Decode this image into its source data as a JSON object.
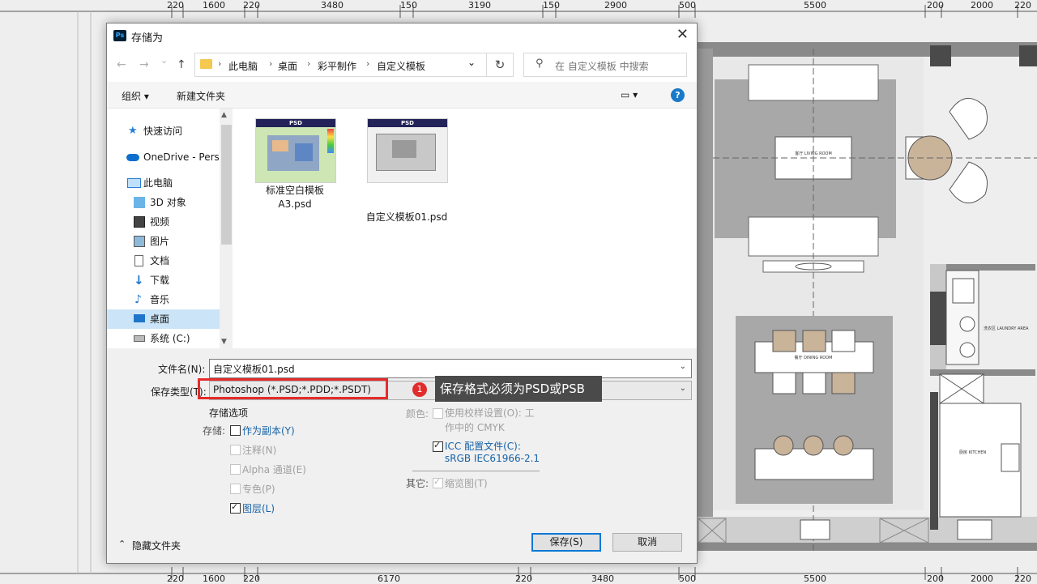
{
  "dialog": {
    "title": "存储为",
    "app_badge": "Ps",
    "close_glyph": "✕"
  },
  "nav": {
    "back_icon": "←",
    "forward_icon": "→",
    "dropdown_icon": "⌄",
    "up_icon": "↑",
    "breadcrumb": [
      "此电脑",
      "桌面",
      "彩平制作",
      "自定义模板"
    ],
    "crumb_sep": "›",
    "refresh_icon": "↻",
    "search_placeholder": "在 自定义模板 中搜索"
  },
  "toolbar": {
    "organize": "组织 ▾",
    "new_folder": "新建文件夹",
    "view_icon": "▭ ▾",
    "help": "?"
  },
  "sidebar": {
    "items": [
      {
        "label": "快速访问",
        "icon": "star-icon"
      },
      {
        "label": "OneDrive - Perso",
        "icon": "cloud-icon"
      },
      {
        "label": "此电脑",
        "icon": "computer-icon"
      },
      {
        "label": "3D 对象",
        "icon": "cube-icon"
      },
      {
        "label": "视频",
        "icon": "video-icon"
      },
      {
        "label": "图片",
        "icon": "picture-icon"
      },
      {
        "label": "文档",
        "icon": "document-icon"
      },
      {
        "label": "下载",
        "icon": "download-icon"
      },
      {
        "label": "音乐",
        "icon": "music-icon"
      },
      {
        "label": "桌面",
        "icon": "desktop-icon"
      },
      {
        "label": "系统 (C:)",
        "icon": "drive-icon"
      }
    ]
  },
  "files": [
    {
      "name_line1": "标准空白模板",
      "name_line2": "A3.psd",
      "badge": "PSD"
    },
    {
      "name_line1": "自定义模板01.psd",
      "name_line2": "",
      "badge": "PSD"
    }
  ],
  "form": {
    "filename_label": "文件名(N):",
    "filename_value": "自定义模板01.psd",
    "filetype_label": "保存类型(T):",
    "filetype_value": "Photoshop (*.PSD;*.PDD;*.PSDT)",
    "save_options_title": "存储选项",
    "storage_label": "存储:",
    "opt_copy": "作为副本(Y)",
    "opt_notes": "注释(N)",
    "opt_alpha": "Alpha 通道(E)",
    "opt_spot": "专色(P)",
    "opt_layers": "图层(L)",
    "color_label": "颜色:",
    "opt_proof_line1": "使用校样设置(O):  工",
    "opt_proof_line2": "作中的 CMYK",
    "opt_icc_line1": "ICC 配置文件(C):",
    "opt_icc_line2": "sRGB IEC61966-2.1",
    "other_label": "其它:",
    "opt_thumb": "缩览图(T)",
    "hide_folders": "隐藏文件夹",
    "save_button": "保存(S)",
    "cancel_button": "取消"
  },
  "checkbox_states": {
    "copy": false,
    "notes": false,
    "alpha": false,
    "spot": false,
    "layers": true,
    "proof": false,
    "icc": true,
    "thumbnail": true
  },
  "annotation": {
    "badge": "1",
    "callout": "保存格式必须为PSD或PSB"
  },
  "ruler_top": [
    "220",
    "1600",
    "220",
    "3480",
    "150",
    "3190",
    "150",
    "2900",
    "500",
    "5500",
    "200",
    "2000",
    "220"
  ],
  "ruler_bottom": [
    "220",
    "1600",
    "220",
    "6170",
    "220",
    "3480",
    "500",
    "5500",
    "200",
    "2000",
    "220"
  ],
  "plan_labels": {
    "living": "客厅 LIVING ROOM",
    "dining": "餐厅 DINING ROOM",
    "laundry": "洗衣区 LAUNDRY AREA",
    "kitchen": "厨房 KITCHEN"
  },
  "colors": {
    "accent": "#0078d7",
    "link": "#1662a6",
    "annotation_red": "#e52b2b",
    "callout_bg": "#4a4a4a",
    "selection": "#cce4f7"
  }
}
